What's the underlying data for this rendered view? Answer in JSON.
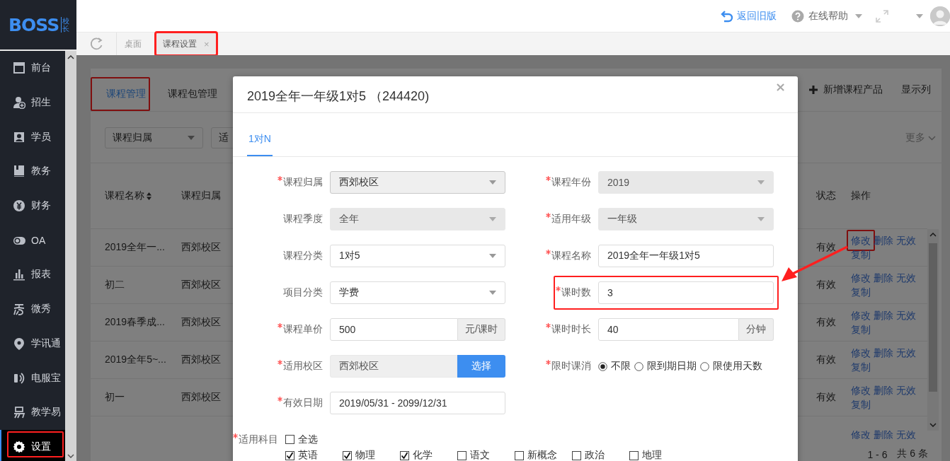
{
  "logo": {
    "text": "BOSS",
    "badge": "校长"
  },
  "sidebar": {
    "items": [
      {
        "label": "前台",
        "selected": false,
        "highlighted": false
      },
      {
        "label": "招生",
        "selected": false,
        "highlighted": false
      },
      {
        "label": "学员",
        "selected": false,
        "highlighted": false
      },
      {
        "label": "教务",
        "selected": false,
        "highlighted": false
      },
      {
        "label": "财务",
        "selected": false,
        "highlighted": false
      },
      {
        "label": "OA",
        "selected": false,
        "highlighted": false
      },
      {
        "label": "报表",
        "selected": false,
        "highlighted": false
      },
      {
        "label": "微秀",
        "selected": false,
        "highlighted": false
      },
      {
        "label": "学讯通",
        "selected": false,
        "highlighted": false
      },
      {
        "label": "电服宝",
        "selected": false,
        "highlighted": false
      },
      {
        "label": "教学易",
        "selected": false,
        "highlighted": false
      },
      {
        "label": "设置",
        "selected": true,
        "highlighted": true
      }
    ]
  },
  "header": {
    "old_version_link": "返回旧版",
    "help_menu": "在线帮助"
  },
  "page_tabs": [
    {
      "label": "桌面",
      "selected": false,
      "highlighted": false
    },
    {
      "label": "课程设置",
      "selected": true,
      "highlighted": true,
      "close": "×"
    }
  ],
  "course_page": {
    "tabs": [
      {
        "label": "课程管理",
        "selected": true,
        "highlighted": true
      },
      {
        "label": "课程包管理",
        "selected": false,
        "highlighted": false
      }
    ],
    "add_button": "新增课程产品",
    "columns_button": "显示列",
    "filters": [
      "课程归属",
      "适"
    ],
    "more_button": "更多",
    "table": {
      "columns": [
        {
          "label": "课程名称",
          "sortable": true
        },
        {
          "label": "课程归属",
          "sortable": false
        },
        {
          "label": "状态",
          "sortable": false
        },
        {
          "label": "操作",
          "sortable": false
        }
      ],
      "rows": [
        {
          "name": "2019全年一...",
          "campus": "西郊校区",
          "status": "有效",
          "actions": [
            {
              "label": "修改",
              "highlighted": true
            },
            {
              "label": "删除",
              "highlighted": false
            },
            {
              "label": "无效",
              "highlighted": false
            },
            {
              "label": "复制",
              "highlighted": false
            }
          ]
        },
        {
          "name": "初二",
          "campus": "西郊校区",
          "status": "有效",
          "actions": [
            {
              "label": "修改",
              "highlighted": false
            },
            {
              "label": "删除",
              "highlighted": false
            },
            {
              "label": "无效",
              "highlighted": false
            },
            {
              "label": "复制",
              "highlighted": false
            }
          ]
        },
        {
          "name": "2019春季成...",
          "campus": "西郊校区",
          "status": "有效",
          "actions": [
            {
              "label": "修改",
              "highlighted": false
            },
            {
              "label": "删除",
              "highlighted": false
            },
            {
              "label": "无效",
              "highlighted": false
            },
            {
              "label": "复制",
              "highlighted": false
            }
          ]
        },
        {
          "name": "2019全年5~...",
          "campus": "西郊校区",
          "status": "有效",
          "actions": [
            {
              "label": "修改",
              "highlighted": false
            },
            {
              "label": "删除",
              "highlighted": false
            },
            {
              "label": "无效",
              "highlighted": false
            },
            {
              "label": "复制",
              "highlighted": false
            }
          ]
        },
        {
          "name": "初一",
          "campus": "西郊校区",
          "status": "有效",
          "actions": [
            {
              "label": "修改",
              "highlighted": false
            },
            {
              "label": "删除",
              "highlighted": false
            },
            {
              "label": "无效",
              "highlighted": false
            },
            {
              "label": "复制",
              "highlighted": false
            }
          ]
        },
        {
          "actions": [
            {
              "label": "修改",
              "highlighted": false
            },
            {
              "label": "删除",
              "highlighted": false
            },
            {
              "label": "无效",
              "highlighted": false
            }
          ]
        }
      ]
    },
    "range": "1 - 6",
    "total": "共 6 条"
  },
  "modal": {
    "title": "2019全年一年级1对5 （244420)",
    "close": "×",
    "tabs": [
      {
        "label": "1对N",
        "selected": true
      }
    ],
    "rows": [
      {
        "left": {
          "label": "课程归属",
          "required": true,
          "kind": "select",
          "value": "西郊校区",
          "disabled": false,
          "readonly": true,
          "highlighted": false
        },
        "right": {
          "label": "课程年份",
          "required": true,
          "kind": "select",
          "value": "2019",
          "disabled": true,
          "readonly": false,
          "highlighted": false
        }
      },
      {
        "left": {
          "label": "课程季度",
          "required": false,
          "kind": "select",
          "value": "全年",
          "disabled": true,
          "readonly": false,
          "highlighted": false
        },
        "right": {
          "label": "适用年级",
          "required": true,
          "kind": "select",
          "value": "一年级",
          "disabled": true,
          "readonly": false,
          "highlighted": false
        }
      },
      {
        "left": {
          "label": "课程分类",
          "required": false,
          "kind": "select",
          "value": "1对5",
          "disabled": false,
          "readonly": false,
          "highlighted": false
        },
        "right": {
          "label": "课程名称",
          "required": true,
          "kind": "input",
          "value": "2019全年一年级1对5",
          "highlighted": false
        }
      },
      {
        "left": {
          "label": "项目分类",
          "required": false,
          "kind": "select",
          "value": "学费",
          "disabled": false,
          "readonly": false,
          "highlighted": false
        },
        "right": {
          "label": "课时数",
          "required": true,
          "kind": "input",
          "value": "3",
          "highlighted": true
        }
      },
      {
        "left": {
          "label": "课程单价",
          "required": true,
          "kind": "input",
          "value": "500",
          "suffix": "元/课时",
          "highlighted": false
        },
        "right": {
          "label": "课时时长",
          "required": true,
          "kind": "input",
          "value": "40",
          "suffix": "分钟",
          "highlighted": false
        }
      },
      {
        "left": {
          "label": "适用校区",
          "required": true,
          "kind": "picker",
          "value": "西郊校区",
          "button": "选择",
          "highlighted": false
        },
        "right": {
          "label": "限时课消",
          "required": true,
          "kind": "radio",
          "highlighted": false,
          "options": [
            {
              "label": "不限",
              "selected": true
            },
            {
              "label": "限到期日期",
              "selected": false
            },
            {
              "label": "限使用天数",
              "selected": false
            }
          ]
        }
      },
      {
        "left": {
          "label": "有效日期",
          "required": true,
          "kind": "input",
          "value": "2019/05/31 - 2099/12/31",
          "highlighted": false
        }
      },
      {
        "left": {
          "label": "适用科目",
          "required": true,
          "kind": "checkboxes",
          "highlighted": false,
          "select_all": {
            "label": "全选",
            "checked": false
          },
          "options": [
            {
              "label": "英语",
              "checked": true
            },
            {
              "label": "物理",
              "checked": true
            },
            {
              "label": "化学",
              "checked": true
            },
            {
              "label": "语文",
              "checked": false
            },
            {
              "label": "新概念",
              "checked": false
            },
            {
              "label": "政治",
              "checked": false
            },
            {
              "label": "地理",
              "checked": false
            }
          ]
        }
      }
    ]
  },
  "annotation_arrow": true
}
